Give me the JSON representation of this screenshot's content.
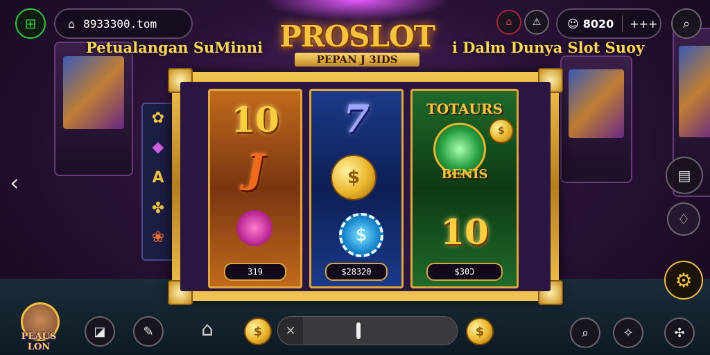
{
  "header": {
    "menu_icon": "grid-icon",
    "url_text": "8933300.tom",
    "account_text": "8020",
    "extra_text": "+++"
  },
  "title": {
    "logo": "PROSLOT",
    "logo_sub": "PEPAN J 3IDS",
    "tagline_left": "Petualangan SuMinni",
    "tagline_right": "i Dalm Dunya Slot Suoy"
  },
  "reels": [
    {
      "top": "10",
      "mid": "J",
      "value": "319"
    },
    {
      "top": "7",
      "value": "$28320"
    },
    {
      "top": "TOTAURS",
      "mid": "BENIS",
      "bottom": "10",
      "value": "$30Ɔ"
    }
  ],
  "side_symbols": [
    "✿",
    "◆",
    "A",
    "✤",
    "❀"
  ],
  "coin_symbol": "$",
  "right_panel": {
    "icons": [
      "chest-icon",
      "diamond-icon",
      "gear-icon"
    ]
  },
  "player": {
    "name": "PEAUS LON"
  },
  "colors": {
    "accent": "#f6c43c",
    "frame": "#d8a640"
  }
}
